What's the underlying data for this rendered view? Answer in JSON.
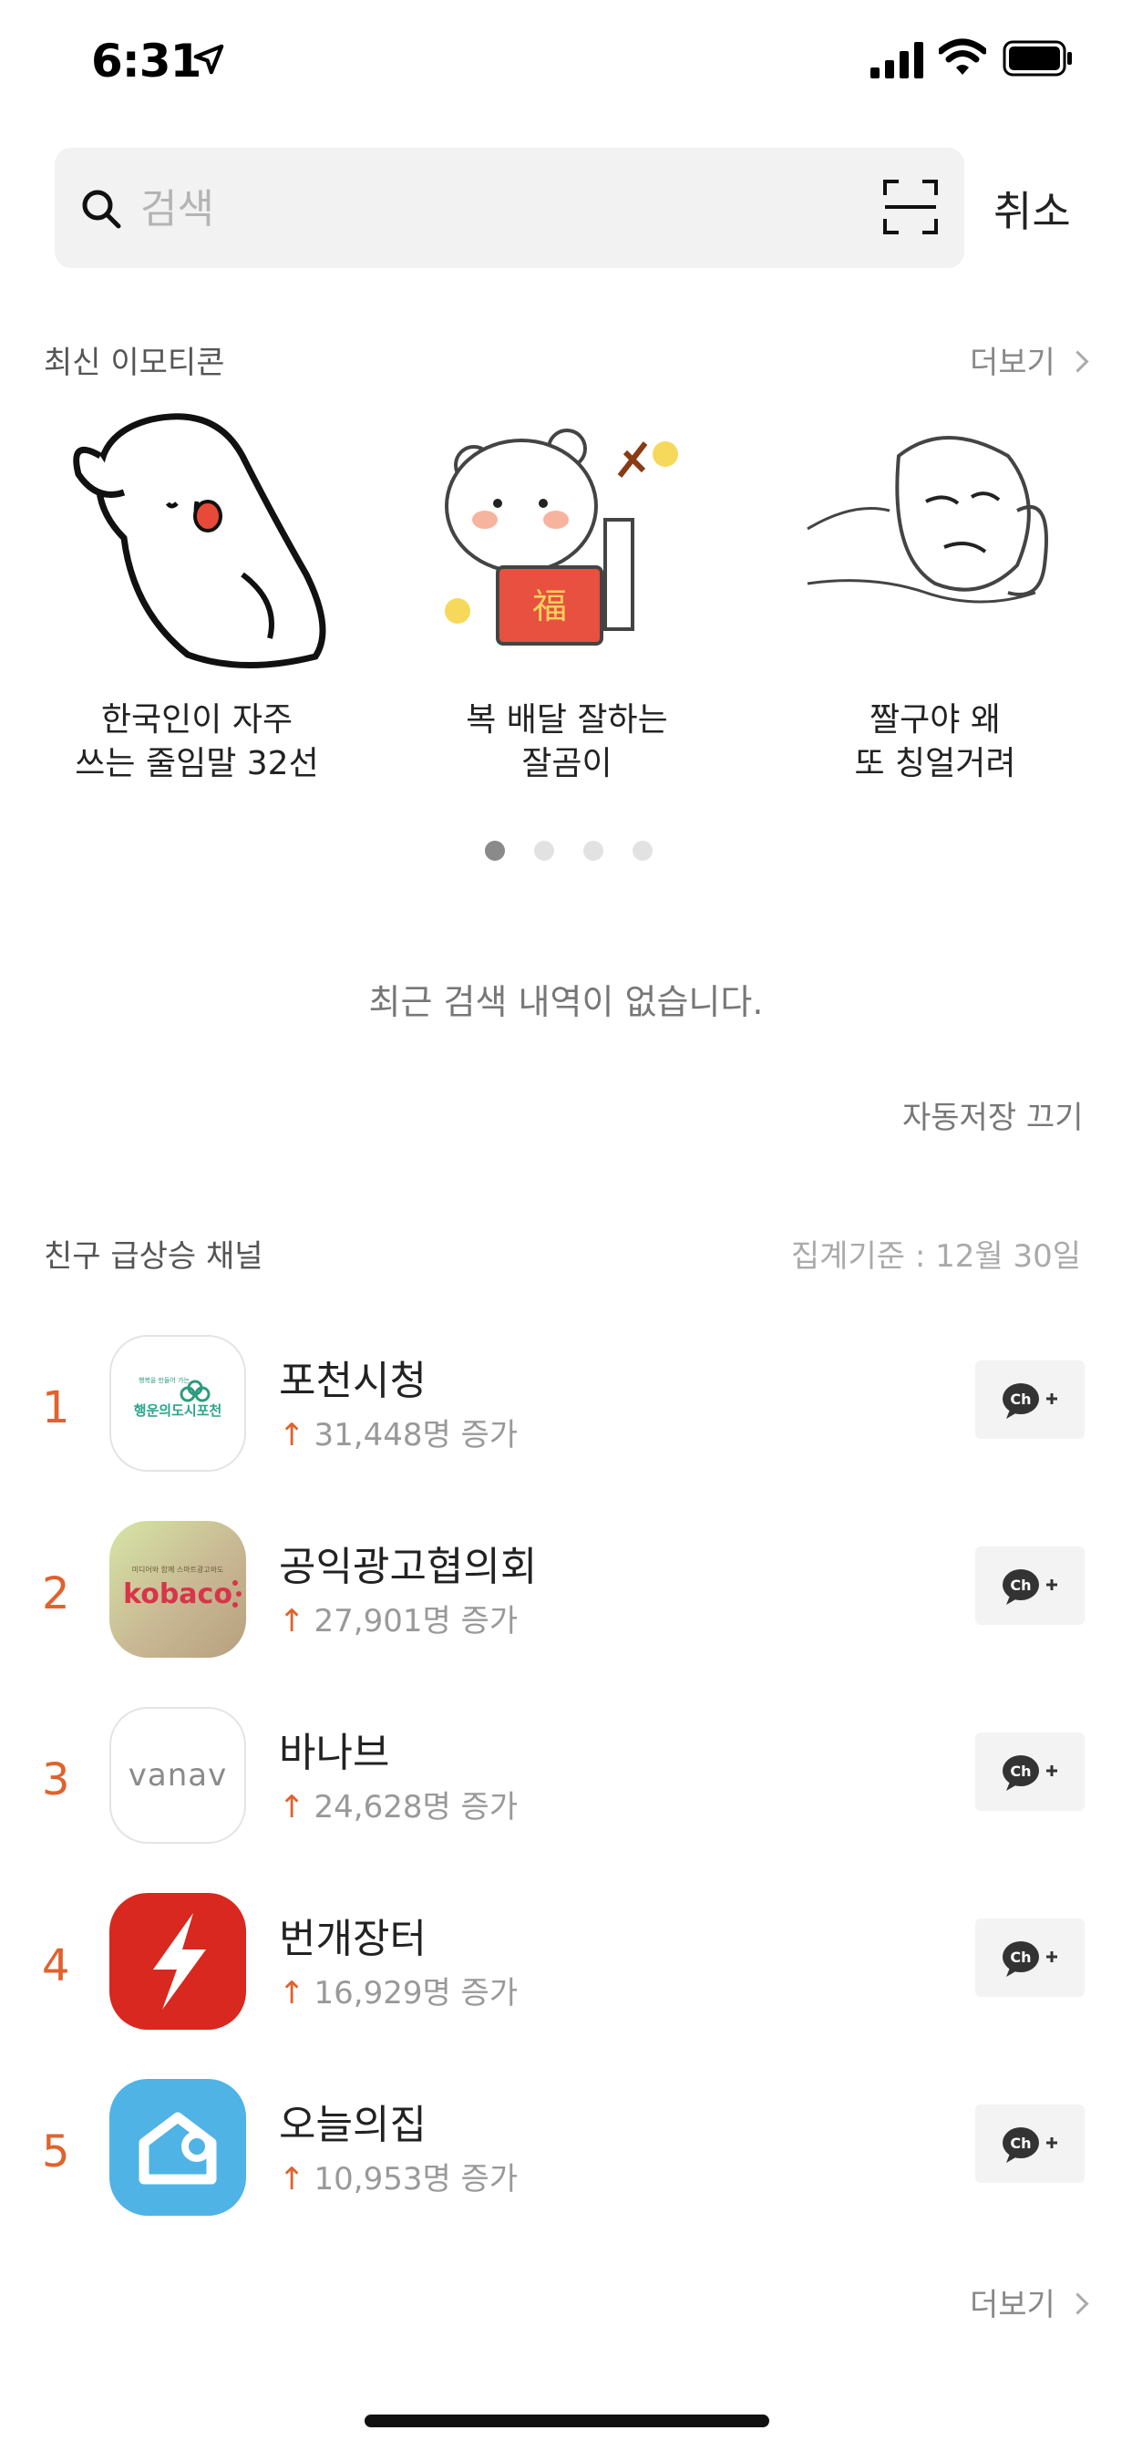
{
  "status_bar": {
    "time": "6:31"
  },
  "search": {
    "placeholder": "검색",
    "cancel_label": "취소"
  },
  "latest_emoticons": {
    "title": "최신 이모티콘",
    "more_label": "더보기",
    "items": [
      {
        "line1": "한국인이 자주",
        "line2": "쓰는 줄임말 32선"
      },
      {
        "line1": "복 배달 잘하는",
        "line2": "잘곰이"
      },
      {
        "line1": "짤구야 왜",
        "line2": "또 칭얼거려"
      }
    ],
    "page_count": 4,
    "active_page": 1
  },
  "recent_search": {
    "empty_message": "최근 검색 내역이 없습니다.",
    "autosave_label": "자동저장 끄기"
  },
  "rising_channels": {
    "title": "친구 급상승 채널",
    "basis": "집계기준 : 12월 30일",
    "more_label": "더보기",
    "up_arrow": "↑",
    "items": [
      {
        "rank": "1",
        "name": "포천시청",
        "increase": "31,448명 증가",
        "logo_text_small": "행복을 만들어 가는",
        "logo_text": "행운의도시포천"
      },
      {
        "rank": "2",
        "name": "공익광고협의회",
        "increase": "27,901명 증가",
        "logo_text_small": "미디어와 함께 스마트광고와도",
        "logo_text": "kobaco"
      },
      {
        "rank": "3",
        "name": "바나브",
        "increase": "24,628명 증가",
        "logo_text": "vanav"
      },
      {
        "rank": "4",
        "name": "번개장터",
        "increase": "16,929명 증가"
      },
      {
        "rank": "5",
        "name": "오늘의집",
        "increase": "10,953명 증가"
      }
    ],
    "add_button_label": "Ch"
  },
  "colors": {
    "accent": "#e0622d",
    "search_bg": "#f2f2f2",
    "bunjang": "#d8281f",
    "ohouse": "#4fb3e6"
  }
}
